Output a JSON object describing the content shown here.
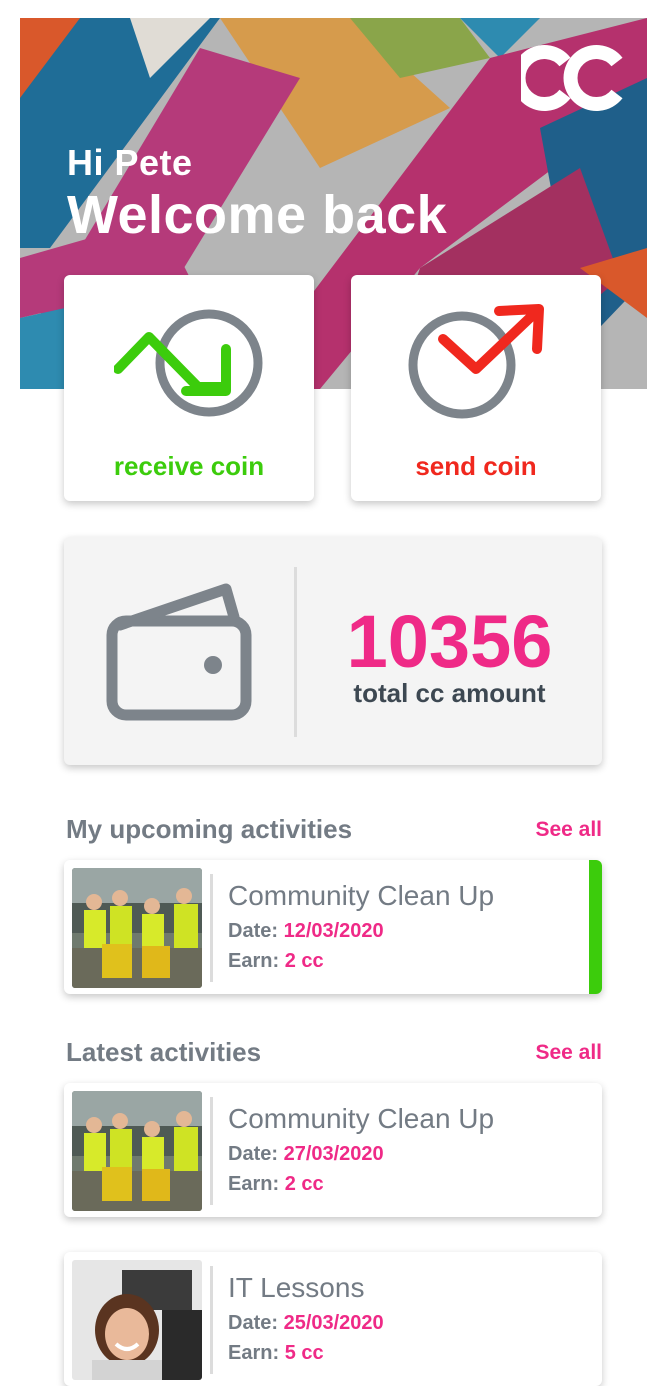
{
  "header": {
    "greeting": "Hi Pete",
    "welcome": "Welcome back",
    "logo_icon": "cc-logo-icon"
  },
  "actions": {
    "receive": {
      "label": "receive coin",
      "icon": "receive-coin-icon",
      "color": "#3ccc0c"
    },
    "send": {
      "label": "send coin",
      "icon": "send-coin-icon",
      "color": "#f0281e"
    }
  },
  "wallet": {
    "icon": "wallet-icon",
    "amount": "10356",
    "label": "total cc amount"
  },
  "upcoming": {
    "title": "My upcoming activities",
    "see_all": "See all",
    "items": [
      {
        "name": "Community Clean Up",
        "date_label": "Date:",
        "date": "12/03/2020",
        "earn_label": "Earn:",
        "earn": "2 cc"
      }
    ]
  },
  "latest": {
    "title": "Latest activities",
    "see_all": "See all",
    "items": [
      {
        "name": "Community Clean Up",
        "date_label": "Date:",
        "date": "27/03/2020",
        "earn_label": "Earn:",
        "earn": "2 cc"
      },
      {
        "name": "IT Lessons",
        "date_label": "Date:",
        "date": "25/03/2020",
        "earn_label": "Earn:",
        "earn": "5 cc"
      }
    ]
  },
  "colors": {
    "accent_pink": "#ef2a87",
    "accent_green": "#3ccc0c",
    "accent_red": "#f0281e"
  }
}
